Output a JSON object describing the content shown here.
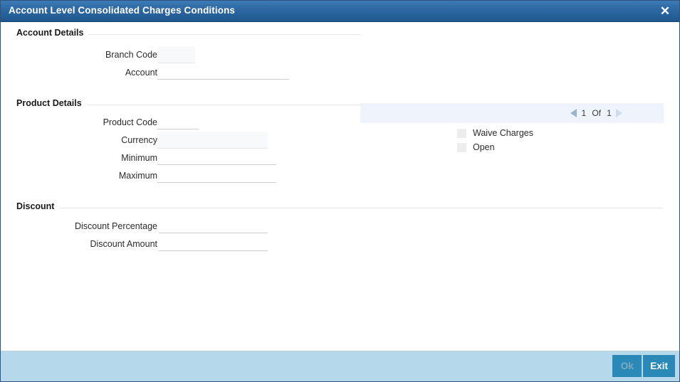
{
  "window": {
    "title": "Account Level Consolidated Charges Conditions",
    "close_icon": "close-icon",
    "title_bg": "#2f6ba6",
    "footer_bg": "#b5d8ea",
    "button_bg": "#2b89b8",
    "panel_bg": "#eef3fc"
  },
  "sections": {
    "account_details": {
      "title": "Account Details",
      "fields": [
        {
          "label": "Branch Code",
          "value": "",
          "placeholder": "",
          "style": "filled"
        },
        {
          "label": "Account",
          "value": "",
          "placeholder": "",
          "style": "underline"
        }
      ]
    },
    "product_details": {
      "title": "Product Details",
      "fields": [
        {
          "label": "Product Code",
          "value": "",
          "placeholder": "",
          "style": "underline"
        },
        {
          "label": "Currency",
          "value": "",
          "placeholder": "",
          "style": "filled"
        },
        {
          "label": "Minimum",
          "value": "",
          "placeholder": "",
          "style": "underline"
        },
        {
          "label": "Maximum",
          "value": "",
          "placeholder": "",
          "style": "underline"
        }
      ],
      "navigator": {
        "prev_icon": "triangle-left-icon",
        "next_icon": "triangle-right-icon",
        "current": "1",
        "of": "Of",
        "total": "1"
      },
      "checkboxes": [
        {
          "label": "Waive Charges",
          "checked": false
        },
        {
          "label": "Open",
          "checked": false
        }
      ]
    },
    "discount": {
      "title": "Discount",
      "fields": [
        {
          "label": "Discount Percentage",
          "value": "",
          "placeholder": "",
          "style": "underline"
        },
        {
          "label": "Discount Amount",
          "value": "",
          "placeholder": "",
          "style": "underline"
        }
      ]
    }
  },
  "footer": {
    "ok_label": "Ok",
    "exit_label": "Exit"
  }
}
